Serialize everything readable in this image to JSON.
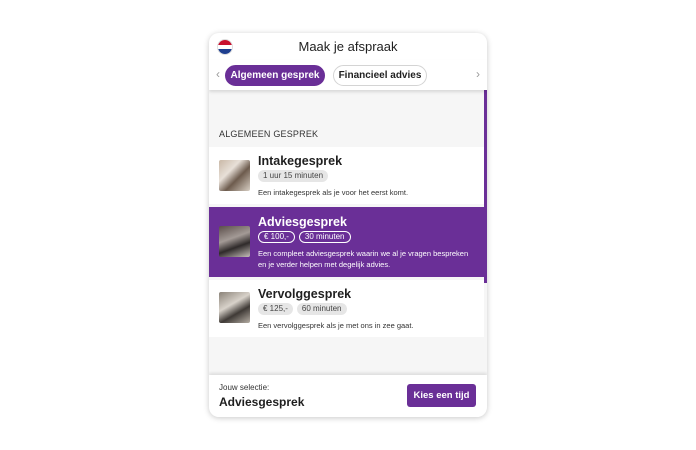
{
  "header": {
    "title": "Maak je afspraak",
    "flag_icon": "netherlands-flag-icon",
    "flag_colors": [
      "#c8102e",
      "#ffffff",
      "#1e3f8f"
    ]
  },
  "tabs": {
    "prev_icon": "chevron-left-icon",
    "next_icon": "chevron-right-icon",
    "prev_glyph": "‹",
    "next_glyph": "›",
    "items": [
      {
        "label": "Algemeen gesprek",
        "active": true
      },
      {
        "label": "Financieel advies",
        "active": false
      }
    ]
  },
  "section": {
    "label": "ALGEMEEN GESPREK"
  },
  "appointments": [
    {
      "title": "Intakegesprek",
      "badges": [
        "1 uur 15 minuten"
      ],
      "description": "Een intakegesprek als je voor het eerst komt.",
      "selected": false
    },
    {
      "title": "Adviesgesprek",
      "badges": [
        "€ 100,-",
        "30 minuten"
      ],
      "description": "Een compleet adviesgesprek waarin we al je vragen bespreken en je verder helpen met degelijk advies.",
      "selected": true
    },
    {
      "title": "Vervolggesprek",
      "badges": [
        "€ 125,-",
        "60 minuten"
      ],
      "description": "Een vervolggesprek als je met ons in zee gaat.",
      "selected": false
    }
  ],
  "footer": {
    "label": "Jouw selectie:",
    "value": "Adviesgesprek",
    "button_label": "Kies een tijd"
  },
  "colors": {
    "accent": "#6a2f97",
    "background": "#f6f6f6"
  }
}
